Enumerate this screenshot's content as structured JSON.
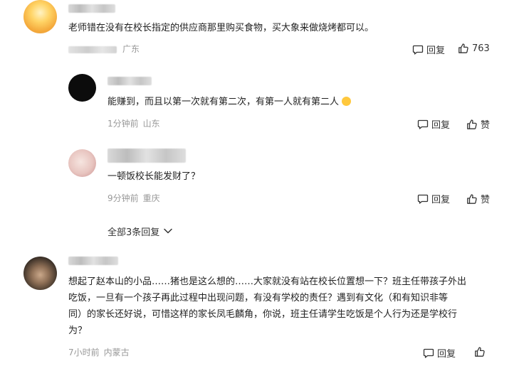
{
  "comments": [
    {
      "text": "老师错在没有在校长指定的供应商那里购买食物，买大象来做烧烤都可以。",
      "region": "广东",
      "reply_label": "回复",
      "like_count": "763"
    }
  ],
  "replies": [
    {
      "text": "能赚到，而且以第一次就有第二次，有第一人就有第二人",
      "time": "1分钟前",
      "region": "山东",
      "reply_label": "回复",
      "like_label": "赞",
      "emoji": "astonished-face"
    },
    {
      "text": "一顿饭校长能发财了？",
      "time": "9分钟前",
      "region": "重庆",
      "reply_label": "回复",
      "like_label": "赞"
    }
  ],
  "expand_replies_label": "全部3条回复",
  "second_comment": {
    "lines": [
      "想起了赵本山的小品……猪也是这么想的……大家就没有站在校长位置想一下？班主任带孩子外出",
      "吃饭，一旦有一个孩子再此过程中出现问题，有没有学校的责任？遇到有文化（和有知识非等",
      "同）的家长还好说，可惜这样的家长凤毛麟角，你说，班主任请学生吃饭是个人行为还是学校行",
      "为？"
    ],
    "time": "7小时前",
    "region": "内蒙古",
    "reply_label": "回复"
  },
  "icons": {
    "reply": "comment-bubble-icon",
    "like": "thumbs-up-icon",
    "expand": "chevron-down-icon"
  }
}
